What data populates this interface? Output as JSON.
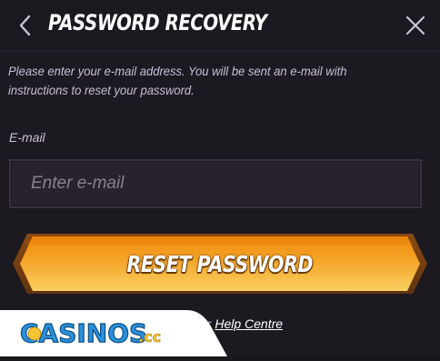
{
  "header": {
    "back_icon": "chevron-left-icon",
    "title": "PASSWORD RECOVERY",
    "close_icon": "close-icon"
  },
  "description": "Please enter your e-mail address. You will be sent an e-mail with instructions to reset your password.",
  "email": {
    "label": "E-mail",
    "placeholder": "Enter e-mail",
    "value": ""
  },
  "reset_button": {
    "label": "RESET PASSWORD"
  },
  "footer": {
    "prefix": "ur",
    "link": "Help Centre"
  },
  "watermark": {
    "text": "CASINOS.cc"
  },
  "colors": {
    "background": "#1d1920",
    "button_orange": "#f39a1a",
    "button_yellow": "#f7c24a",
    "text_muted": "#c6bfd8",
    "input_bg": "#27222c"
  }
}
